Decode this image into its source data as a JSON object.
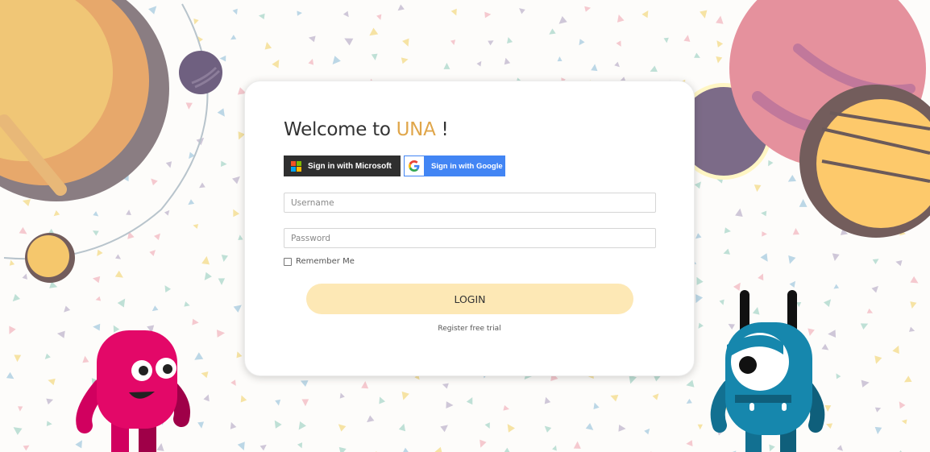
{
  "login": {
    "title_prefix": "Welcome to ",
    "title_brand": "UNA",
    "title_suffix": " !",
    "microsoft_label": "Sign in with Microsoft",
    "google_label": "Sign in with Google",
    "username_placeholder": "Username",
    "password_placeholder": "Password",
    "remember_label": "Remember Me",
    "login_label": "LOGIN",
    "register_label": "Register free trial"
  },
  "colors": {
    "brand_accent": "#e0a64a",
    "login_button": "#fde8b5",
    "microsoft_button": "#2f2f2f",
    "google_button": "#4285f4"
  },
  "icons": {
    "microsoft": "microsoft-logo-icon",
    "google": "google-logo-icon"
  }
}
